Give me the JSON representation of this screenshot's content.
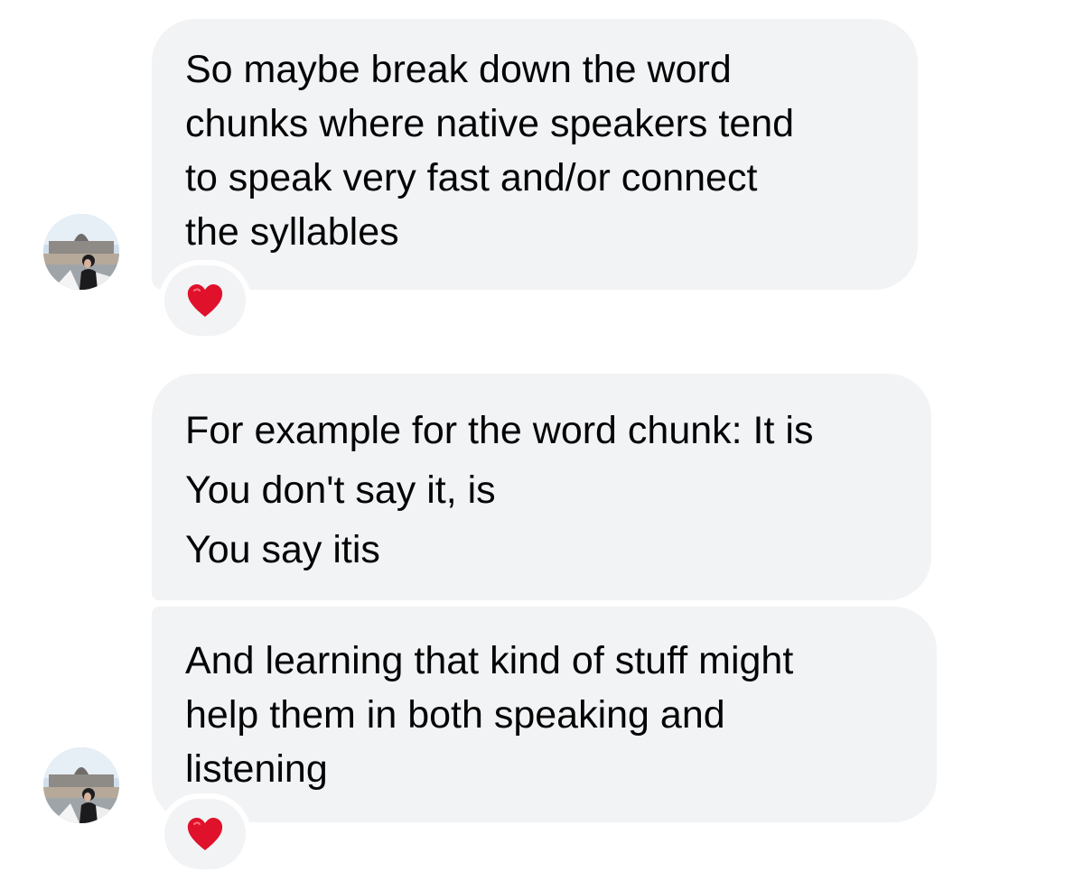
{
  "messages": [
    {
      "text": "So maybe break down the word\nchunks where native speakers tend\nto speak very fast and/or connect\nthe syllables",
      "reaction": "heart"
    },
    {
      "text": "For example for the word chunk: It is\nYou don't say it, is\nYou say itis"
    },
    {
      "text": "And learning that kind of stuff might\nhelp them in both speaking and\nlistening",
      "reaction": "heart"
    }
  ],
  "colors": {
    "bubble_background": "#f2f3f5",
    "text": "#050505",
    "heart": "#e0112b",
    "page_background": "#ffffff"
  },
  "icons": {
    "avatar": "sender-avatar",
    "reaction": "red-heart-icon"
  }
}
